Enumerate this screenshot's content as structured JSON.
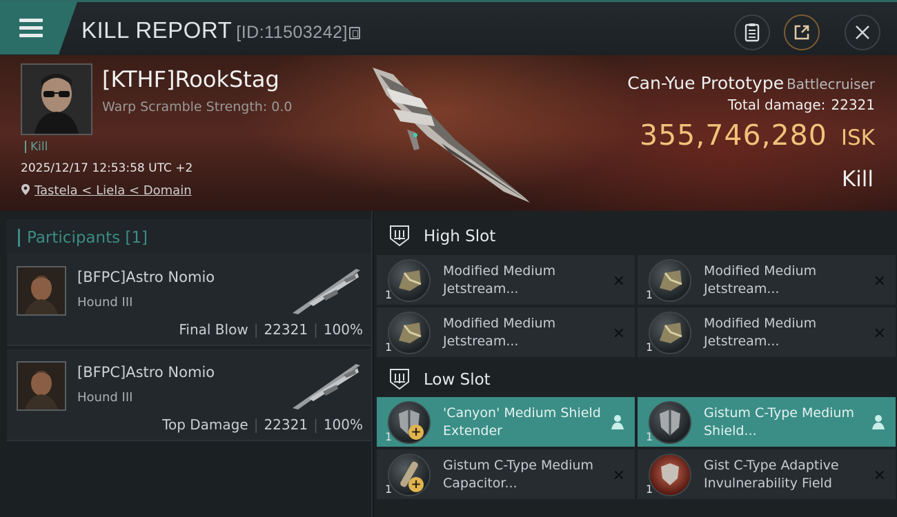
{
  "window": {
    "title": "KILL REPORT",
    "kill_id": "[ID:11503242]",
    "icons": [
      "menu-icon",
      "copy-icon",
      "clipboard-icon",
      "share-icon",
      "close-icon"
    ]
  },
  "victim": {
    "name": "[KTHF]RookStag",
    "warp_scramble": "Warp Scramble Strength: 0.0",
    "tag": "Kill",
    "datetime": "2025/12/17 12:53:58 UTC +2",
    "location": "Tastela < Liela < Domain",
    "ship": "Can-Yue Prototype",
    "ship_class": "Battlecruiser",
    "total_damage_label": "Total damage:",
    "total_damage": "22321",
    "isk_value": "355,746,280",
    "isk_unit": "ISK",
    "result": "Kill"
  },
  "participants": {
    "header": "Participants [1]",
    "items": [
      {
        "name": "[BFPC]Astro Nomio",
        "ship": "Hound III",
        "role": "Final Blow",
        "damage": "22321",
        "percent": "100%"
      },
      {
        "name": "[BFPC]Astro Nomio",
        "ship": "Hound III",
        "role": "Top Damage",
        "damage": "22321",
        "percent": "100%"
      }
    ]
  },
  "fitting": {
    "high_slot_title": "High Slot",
    "low_slot_title": "Low Slot",
    "high": [
      {
        "name": "Modified Medium Jetstream...",
        "qty": "1"
      },
      {
        "name": "Modified Medium Jetstream...",
        "qty": "1"
      },
      {
        "name": "Modified Medium Jetstream...",
        "qty": "1"
      },
      {
        "name": "Modified Medium Jetstream...",
        "qty": "1"
      }
    ],
    "low": [
      {
        "name": "'Canyon' Medium Shield Extender",
        "qty": "1"
      },
      {
        "name": "Gistum C-Type Medium Shield...",
        "qty": "1"
      },
      {
        "name": "Gistum C-Type Medium Capacitor...",
        "qty": "1"
      },
      {
        "name": "Gist C-Type Adaptive Invulnerability Field",
        "qty": "1"
      }
    ]
  },
  "colors": {
    "accent_teal": "#3a8e86",
    "isk_gold": "#f1c27a",
    "hero_red": "#532820"
  }
}
